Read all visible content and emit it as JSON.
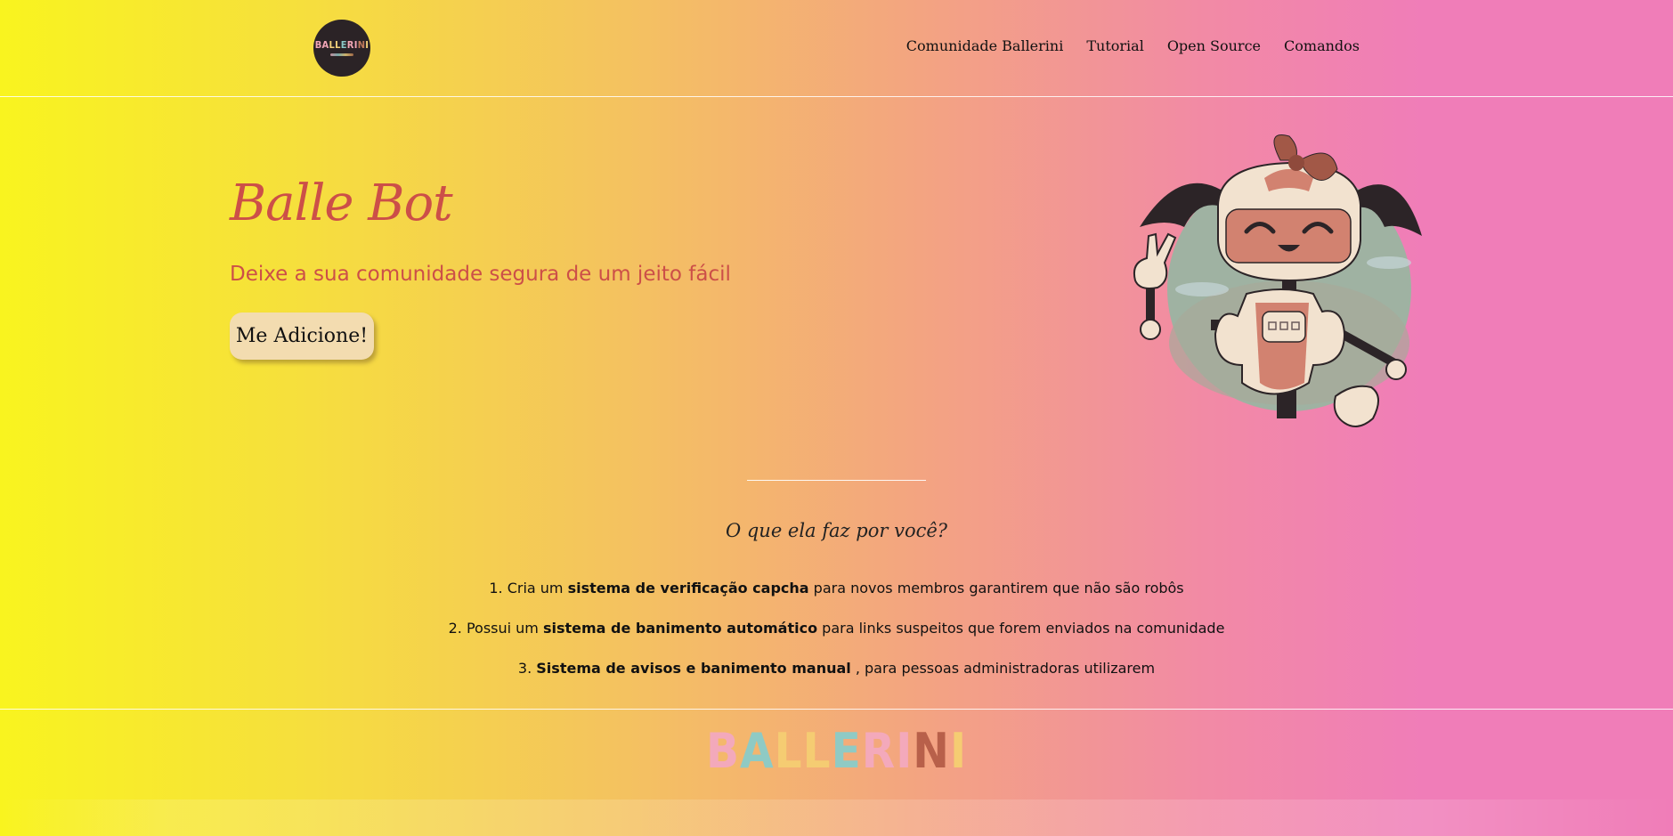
{
  "header": {
    "logo": {
      "text": "BALLERINI",
      "letters": [
        {
          "ch": "B",
          "color": "#f2a6b6"
        },
        {
          "ch": "A",
          "color": "#f2a6b6"
        },
        {
          "ch": "L",
          "color": "#f6d27a"
        },
        {
          "ch": "L",
          "color": "#f6d27a"
        },
        {
          "ch": "E",
          "color": "#8cc9c7"
        },
        {
          "ch": "R",
          "color": "#f2a6b6"
        },
        {
          "ch": "I",
          "color": "#f2a6b6"
        },
        {
          "ch": "N",
          "color": "#c07a5c"
        },
        {
          "ch": "I",
          "color": "#f6d27a"
        }
      ]
    },
    "nav": [
      {
        "label": "Comunidade Ballerini"
      },
      {
        "label": "Tutorial"
      },
      {
        "label": "Open Source"
      },
      {
        "label": "Comandos"
      }
    ]
  },
  "hero": {
    "title": "Balle Bot",
    "subtitle": "Deixe a sua comunidade segura de um jeito fácil",
    "cta_label": "Me Adicione!"
  },
  "features": {
    "title": "O que ela faz por você?",
    "items": [
      {
        "prefix": "1. Cria um ",
        "bold": "sistema de verificação capcha",
        "suffix": " para novos membros garantirem que não são robôs"
      },
      {
        "prefix": "2. Possui um ",
        "bold": "sistema de banimento automático",
        "suffix": " para links suspeitos que forem enviados na comunidade"
      },
      {
        "prefix": "3. ",
        "bold": "Sistema de avisos e banimento manual",
        "suffix": " , para pessoas administradoras utilizarem"
      }
    ]
  },
  "footer": {
    "logo_letters": [
      {
        "ch": "B",
        "color": "#f3a9bb"
      },
      {
        "ch": "A",
        "color": "#8fcac4"
      },
      {
        "ch": "L",
        "color": "#f5cc72"
      },
      {
        "ch": "L",
        "color": "#f5cc72"
      },
      {
        "ch": "E",
        "color": "#8fcac4"
      },
      {
        "ch": "R",
        "color": "#f3a9bb"
      },
      {
        "ch": "I",
        "color": "#f3a9bb"
      },
      {
        "ch": "N",
        "color": "#b8604a"
      },
      {
        "ch": "I",
        "color": "#f5cc72"
      }
    ]
  },
  "colors": {
    "accent": "#cc4f48",
    "button_bg": "#f3dcb0"
  }
}
